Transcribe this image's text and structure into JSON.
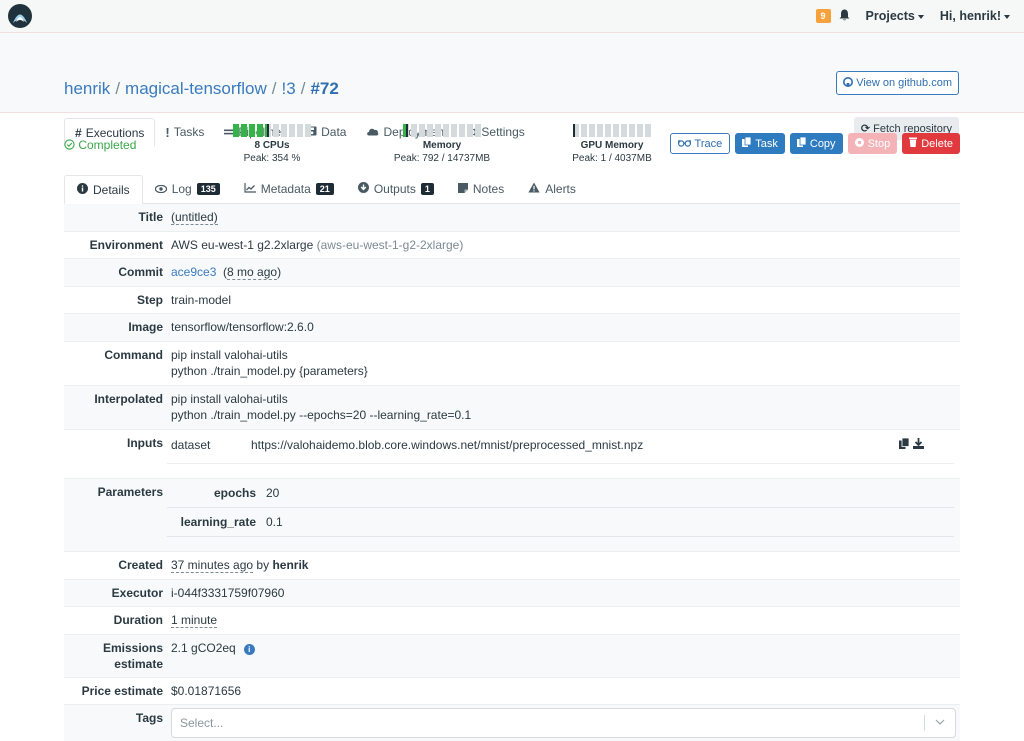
{
  "topbar": {
    "notifications_count": "9",
    "projects_label": "Projects",
    "user_greeting": "Hi, henrik!"
  },
  "breadcrumb": {
    "owner": "henrik",
    "project": "magical-tensorflow",
    "task": "!3",
    "execution": "#72",
    "separator": "/"
  },
  "header": {
    "github_button": "View on github.com",
    "fetch_button": "Fetch repository"
  },
  "main_tabs": [
    {
      "icon": "#",
      "label": "Executions",
      "active": true
    },
    {
      "icon": "!",
      "label": "Tasks"
    },
    {
      "icon": "=",
      "label": "Pipelines"
    },
    {
      "icon": "floppy",
      "label": "Data"
    },
    {
      "icon": "cloud",
      "label": "Deployment"
    },
    {
      "icon": "gear",
      "label": "Settings"
    }
  ],
  "status": {
    "label": "Completed",
    "color": "#3aa64a"
  },
  "meters": [
    {
      "label": "8 CPUs",
      "peak": "Peak: 354 %",
      "fill_fraction": 0.44
    },
    {
      "label": "Memory",
      "peak": "Peak: 792 / 14737MB",
      "fill_fraction": 0.054
    },
    {
      "label": "GPU Memory",
      "peak": "Peak: 1 / 4037MB",
      "fill_fraction": 0.0
    }
  ],
  "actions": {
    "trace": "Trace",
    "task": "Task",
    "copy": "Copy",
    "stop": "Stop",
    "delete": "Delete"
  },
  "sub_tabs": [
    {
      "label": "Details",
      "active": true
    },
    {
      "label": "Log",
      "count": "135"
    },
    {
      "label": "Metadata",
      "count": "21"
    },
    {
      "label": "Outputs",
      "count": "1"
    },
    {
      "label": "Notes"
    },
    {
      "label": "Alerts"
    }
  ],
  "details": {
    "title": {
      "label": "Title",
      "value": "(untitled)"
    },
    "environment": {
      "label": "Environment",
      "value": "AWS eu-west-1 g2.2xlarge",
      "slug": "(aws-eu-west-1-g2-2xlarge)"
    },
    "commit": {
      "label": "Commit",
      "hash": "ace9ce3",
      "age": "8 mo ago"
    },
    "step": {
      "label": "Step",
      "value": "train-model"
    },
    "image": {
      "label": "Image",
      "value": "tensorflow/tensorflow:2.6.0"
    },
    "command": {
      "label": "Command",
      "lines": [
        "pip install valohai-utils",
        "python ./train_model.py {parameters}"
      ]
    },
    "interpolated": {
      "label": "Interpolated",
      "lines": [
        "pip install valohai-utils",
        "python ./train_model.py --epochs=20 --learning_rate=0.1"
      ]
    },
    "inputs": {
      "label": "Inputs",
      "items": [
        {
          "name": "dataset",
          "url": "https://valohaidemo.blob.core.windows.net/mnist/preprocessed_mnist.npz"
        }
      ]
    },
    "parameters": {
      "label": "Parameters",
      "items": [
        {
          "name": "epochs",
          "value": "20"
        },
        {
          "name": "learning_rate",
          "value": "0.1"
        }
      ]
    },
    "created": {
      "label": "Created",
      "ago": "37 minutes ago",
      "by": "by",
      "user": "henrik"
    },
    "executor": {
      "label": "Executor",
      "value": "i-044f3331759f07960"
    },
    "duration": {
      "label": "Duration",
      "value": "1 minute"
    },
    "emissions": {
      "label_line1": "Emissions",
      "label_line2": "estimate",
      "value": "2.1 gCO2eq"
    },
    "price": {
      "label": "Price estimate",
      "value": "$0.01871656"
    },
    "tags": {
      "label": "Tags",
      "placeholder": "Select..."
    }
  }
}
